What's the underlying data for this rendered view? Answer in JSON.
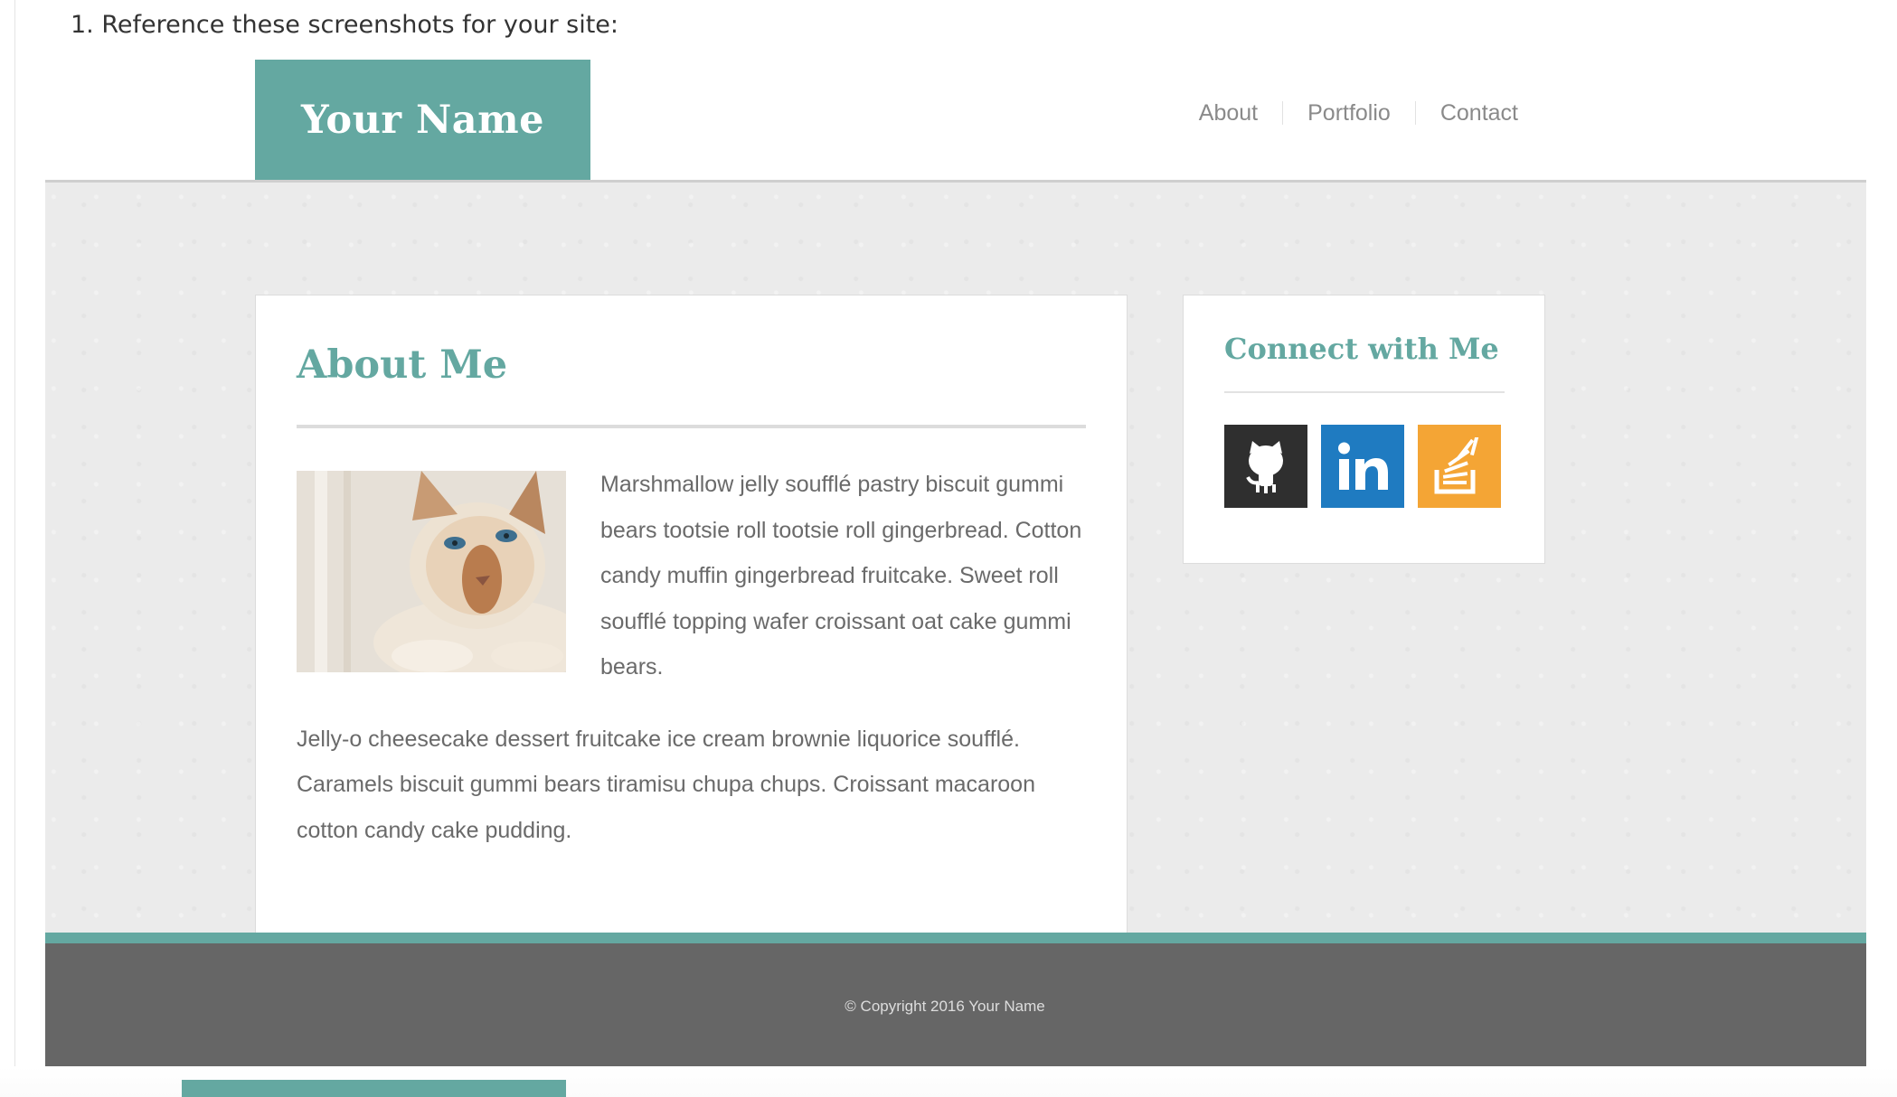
{
  "instruction": "1. Reference these screenshots for your site:",
  "header": {
    "logo": "Your Name",
    "nav": [
      "About",
      "Portfolio",
      "Contact"
    ]
  },
  "about": {
    "title": "About Me",
    "paragraphs": [
      "Marshmallow jelly soufflé pastry biscuit gummi bears tootsie roll tootsie roll gingerbread. Cotton candy muffin gingerbread fruitcake. Sweet roll soufflé topping wafer croissant oat cake gummi bears.",
      "Jelly-o cheesecake dessert fruitcake ice cream brownie liquorice soufflé. Caramels biscuit gummi bears tiramisu chupa chups. Croissant macaroon cotton candy cake pudding."
    ]
  },
  "connect": {
    "title": "Connect with Me",
    "links": [
      {
        "icon": "github-icon",
        "color": "#2f2f2f"
      },
      {
        "icon": "linkedin-icon",
        "color": "#1f7bc1"
      },
      {
        "icon": "stackoverflow-icon",
        "color": "#f4a535"
      }
    ]
  },
  "footer": {
    "copyright": "© Copyright 2016 Your Name"
  },
  "colors": {
    "accent": "#64a8a1",
    "footer": "#666666",
    "content_bg": "#ebebeb"
  }
}
